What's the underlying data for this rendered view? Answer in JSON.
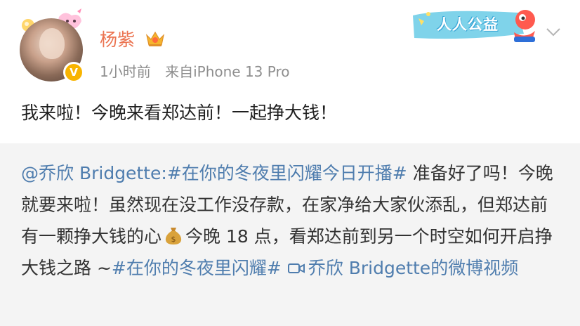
{
  "post": {
    "author": "杨紫",
    "time": "1小时前",
    "source": "来自iPhone 13 Pro",
    "text": "我来啦！今晚来看郑达前！一起挣大钱！"
  },
  "promo_badge": {
    "label": "人人公益"
  },
  "repost": {
    "mention": "@乔欣 Bridgette:",
    "hashtag1": "#在你的冬夜里闪耀今日开播#",
    "text1": " 准备好了吗！今晚就要来啦！虽然现在没工作没存款，在家净给大家伙添乱，但郑达前有一颗挣大钱的心",
    "text2": "今晚 18 点，看郑达前到另一个时空如何开启挣大钱之路 ~",
    "hashtag2": "#在你的冬夜里闪耀#",
    "video_link": "乔欣 Bridgette的微博视频"
  },
  "colors": {
    "username": "#eb7350",
    "link": "#4f7dae",
    "meta": "#8e8e8e",
    "repost_bg": "#f4f4f4",
    "verified": "#f8b400"
  },
  "icons": [
    "crown-icon",
    "verified-icon",
    "chevron-down-icon",
    "money-bag-icon",
    "video-icon",
    "mascot-icon"
  ]
}
